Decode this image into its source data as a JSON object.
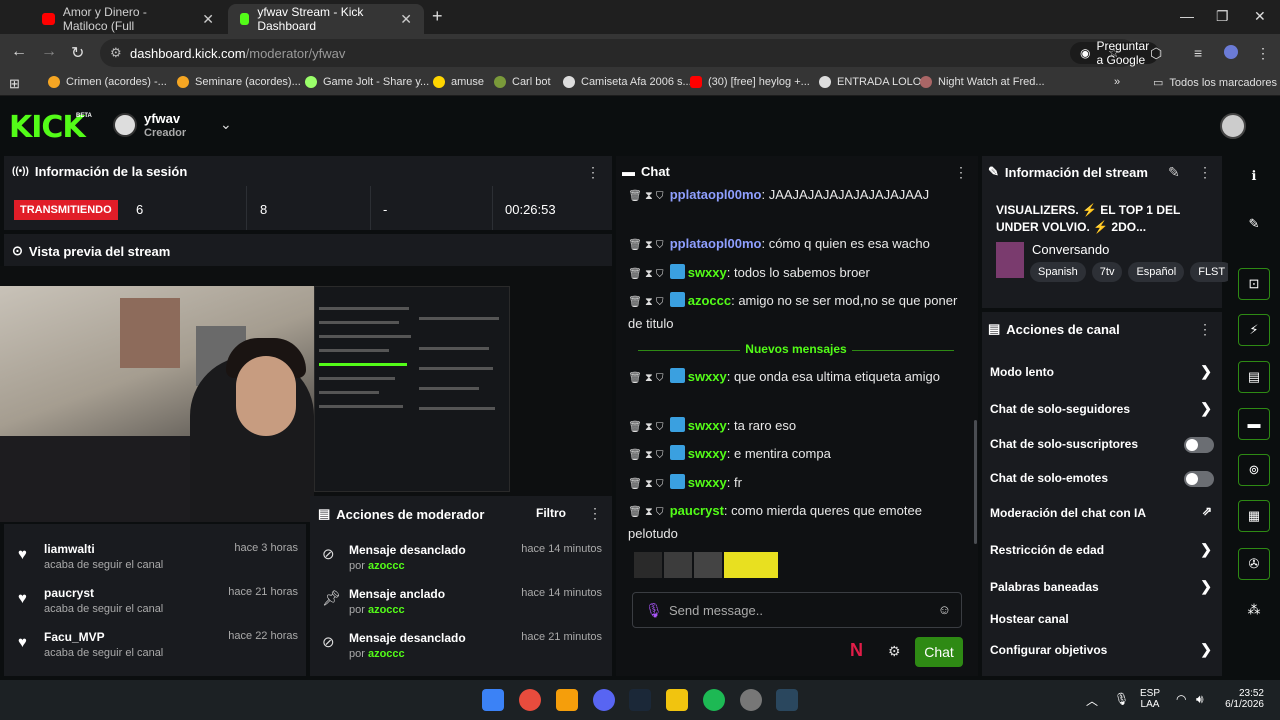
{
  "browser": {
    "tabs": [
      {
        "label": "Amor y Dinero - Matiloco (Full",
        "color": "#ff0000"
      },
      {
        "label": "yfwav Stream - Kick Dashboard",
        "color": "#53fc18"
      }
    ],
    "url_host": "dashboard.kick.com",
    "url_path": "/moderator/yfwav",
    "google_button": "Preguntar a Google",
    "bookmarks": [
      "Crimen (acordes) -...",
      "Seminare (acordes)...",
      "Game Jolt - Share y...",
      "amuse",
      "Carl bot",
      "Camiseta Afa 2006 s...",
      "(30) [free] heylog +...",
      "ENTRADA LOLO",
      "Night Watch at Fred..."
    ],
    "all_bookmarks": "Todos los marcadores"
  },
  "header": {
    "logo": "KICK",
    "beta": "BETA",
    "channel_name": "yfwav",
    "channel_role": "Creador"
  },
  "session": {
    "title": "Información de la sesión",
    "live_label": "TRANSMITIENDO",
    "stats": [
      "6",
      "8",
      "-",
      "00:26:53"
    ]
  },
  "preview": {
    "title": "Vista previa del stream"
  },
  "follows": [
    {
      "name": "liamwalti",
      "sub": "acaba de seguir el canal",
      "time": "hace 3 horas"
    },
    {
      "name": "paucryst",
      "sub": "acaba de seguir el canal",
      "time": "hace 21 horas"
    },
    {
      "name": "Facu_MVP",
      "sub": "acaba de seguir el canal",
      "time": "hace 22 horas"
    }
  ],
  "mod_actions": {
    "title": "Acciones de moderador",
    "filter": "Filtro",
    "by_prefix": "por",
    "items": [
      {
        "action": "Mensaje desanclado",
        "by": "azoccc",
        "time": "hace 14 minutos",
        "icon": "unpin-icon"
      },
      {
        "action": "Mensaje anclado",
        "by": "azoccc",
        "time": "hace 14 minutos",
        "icon": "pin-icon"
      },
      {
        "action": "Mensaje desanclado",
        "by": "azoccc",
        "time": "hace 21 minutos",
        "icon": "unpin-icon"
      }
    ]
  },
  "chat": {
    "title": "Chat",
    "new_messages": "Nuevos mensajes",
    "placeholder": "Send message..",
    "send": "Chat",
    "messages": [
      {
        "user": "pplataopl00mo",
        "color": "#8f9fff",
        "text": "JAAJAJAJAJAJAJAJAJAAJ",
        "badge": false
      },
      {
        "user": "pplataopl00mo",
        "color": "#8f9fff",
        "text": "cómo q quien es esa wacho",
        "badge": false
      },
      {
        "user": "swxxy",
        "color": "#53fc18",
        "text": "todos lo sabemos broer",
        "badge": true
      },
      {
        "user": "azoccc",
        "color": "#53fc18",
        "text": "amigo no se ser mod,no se que poner de titulo",
        "badge": true
      },
      {
        "user": "swxxy",
        "color": "#53fc18",
        "text": "que onda esa ultima etiqueta amigo",
        "badge": true
      },
      {
        "user": "swxxy",
        "color": "#53fc18",
        "text": "ta raro eso",
        "badge": true
      },
      {
        "user": "swxxy",
        "color": "#53fc18",
        "text": "e mentira compa",
        "badge": true
      },
      {
        "user": "swxxy",
        "color": "#53fc18",
        "text": "fr",
        "badge": true
      },
      {
        "user": "paucryst",
        "color": "#53fc18",
        "text": "como mierda queres que emotee pelotudo",
        "badge": false
      }
    ]
  },
  "stream_info": {
    "title": "Información del stream",
    "stream_title": "VISUALIZERS. ⚡ EL TOP 1 DEL UNDER VOLVIO. ⚡ 2DO...",
    "category": "Conversando",
    "tags": [
      "Spanish",
      "7tv",
      "Español",
      "FLST"
    ]
  },
  "channel_actions": {
    "title": "Acciones de canal",
    "items": [
      {
        "label": "Modo lento",
        "control": "arrow"
      },
      {
        "label": "Chat de solo-seguidores",
        "control": "arrow"
      },
      {
        "label": "Chat de solo-suscriptores",
        "control": "toggle",
        "on": false
      },
      {
        "label": "Chat de solo-emotes",
        "control": "toggle",
        "on": false
      },
      {
        "label": "Moderación del chat con IA",
        "control": "external"
      },
      {
        "label": "Restricción de edad",
        "control": "arrow"
      },
      {
        "label": "Palabras baneadas",
        "control": "arrow"
      },
      {
        "label": "Hostear canal",
        "control": "none"
      },
      {
        "label": "Configurar objetivos",
        "control": "arrow"
      }
    ]
  },
  "taskbar": {
    "lang1": "ESP",
    "lang2": "LAA",
    "time": "23:52",
    "date": "6/1/2026"
  }
}
